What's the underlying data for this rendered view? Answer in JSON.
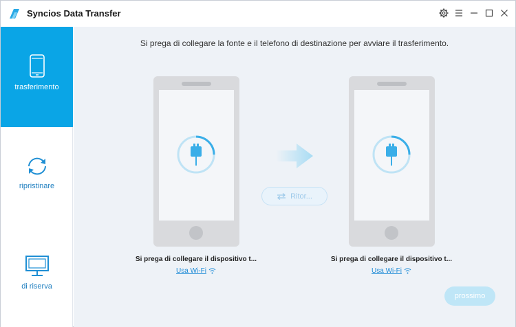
{
  "app": {
    "title": "Syncios Data Transfer",
    "accent_color": "#0aa5e6"
  },
  "sidebar": {
    "items": [
      {
        "label": "trasferimento",
        "icon": "phone-icon",
        "active": true
      },
      {
        "label": "ripristinare",
        "icon": "sync-icon",
        "active": false
      },
      {
        "label": "di riserva",
        "icon": "monitor-icon",
        "active": false
      }
    ]
  },
  "main": {
    "instruction": "Si prega di collegare la fonte e il telefono di destinazione per avviare il trasferimento.",
    "source": {
      "caption": "Si prega di collegare il dispositivo t...",
      "wifi_label": "Usa Wi-Fi"
    },
    "target": {
      "caption": "Si prega di collegare il dispositivo t...",
      "wifi_label": "Usa Wi-Fi"
    },
    "swap_label": "Ritor...",
    "next_label": "prossimo"
  }
}
